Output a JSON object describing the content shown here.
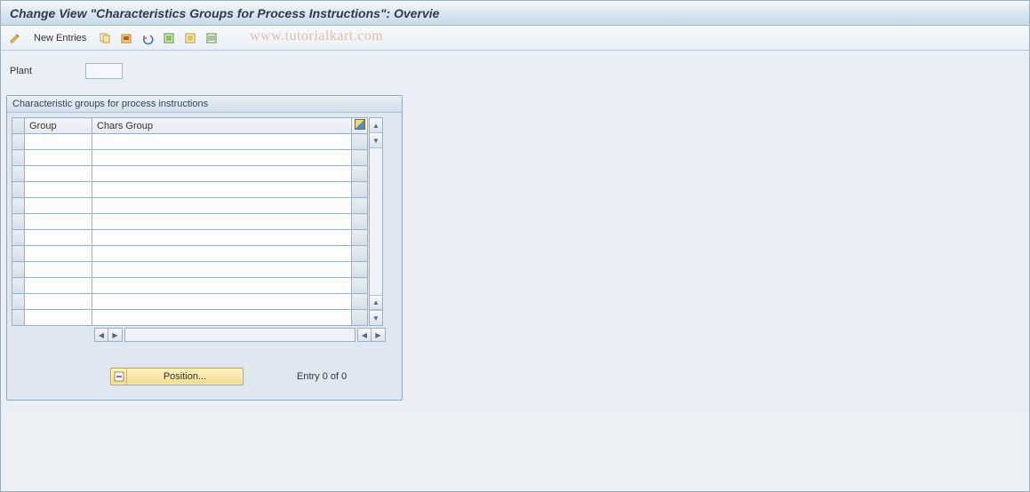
{
  "window": {
    "title": "Change View \"Characteristics Groups for Process Instructions\": Overvie"
  },
  "toolbar": {
    "new_entries_label": "New Entries"
  },
  "watermark": "www.tutorialkart.com",
  "form": {
    "plant_label": "Plant",
    "plant_value": ""
  },
  "panel": {
    "title": "Characteristic groups for process instructions",
    "columns": {
      "group": "Group",
      "chars_group": "Chars Group"
    },
    "rows": [
      {
        "group": "",
        "chars_group": ""
      },
      {
        "group": "",
        "chars_group": ""
      },
      {
        "group": "",
        "chars_group": ""
      },
      {
        "group": "",
        "chars_group": ""
      },
      {
        "group": "",
        "chars_group": ""
      },
      {
        "group": "",
        "chars_group": ""
      },
      {
        "group": "",
        "chars_group": ""
      },
      {
        "group": "",
        "chars_group": ""
      },
      {
        "group": "",
        "chars_group": ""
      },
      {
        "group": "",
        "chars_group": ""
      },
      {
        "group": "",
        "chars_group": ""
      },
      {
        "group": "",
        "chars_group": ""
      }
    ]
  },
  "footer": {
    "position_label": "Position...",
    "entry_text": "Entry 0 of 0"
  }
}
